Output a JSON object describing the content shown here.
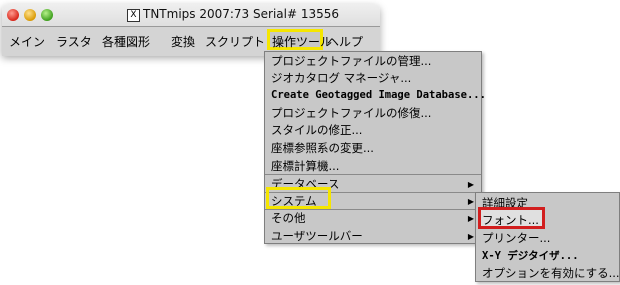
{
  "window": {
    "title": "TNTmips 2007:73  Serial# 13556",
    "x_icon": "X"
  },
  "menubar": {
    "items": [
      {
        "label": "メイン"
      },
      {
        "label": "ラスタ"
      },
      {
        "label": "各種図形"
      },
      {
        "label": "変換"
      },
      {
        "label": "スクリプト"
      },
      {
        "label": "操作ツール"
      },
      {
        "label": "ヘルプ"
      }
    ]
  },
  "tools_menu": {
    "items": [
      {
        "label": "プロジェクトファイルの管理..."
      },
      {
        "label": "ジオカタログ マネージャ..."
      },
      {
        "label": "Create Geotagged Image Database..."
      },
      {
        "label": "プロジェクトファイルの修復..."
      },
      {
        "label": "スタイルの修正..."
      },
      {
        "label": "座標参照系の変更..."
      },
      {
        "label": "座標計算機..."
      },
      {
        "label": "データベース"
      },
      {
        "label": "システム"
      },
      {
        "label": "その他"
      },
      {
        "label": "ユーザツールバー"
      }
    ]
  },
  "system_submenu": {
    "items": [
      {
        "label": "詳細設定"
      },
      {
        "label": "フォント..."
      },
      {
        "label": "プリンター..."
      },
      {
        "label": "X-Y デジタイザ..."
      },
      {
        "label": "オプションを有効にする..."
      }
    ]
  },
  "colors": {
    "highlight_yellow": "#f5e600",
    "highlight_red": "#d21e1e",
    "menu_bg": "#c8c8c8"
  }
}
